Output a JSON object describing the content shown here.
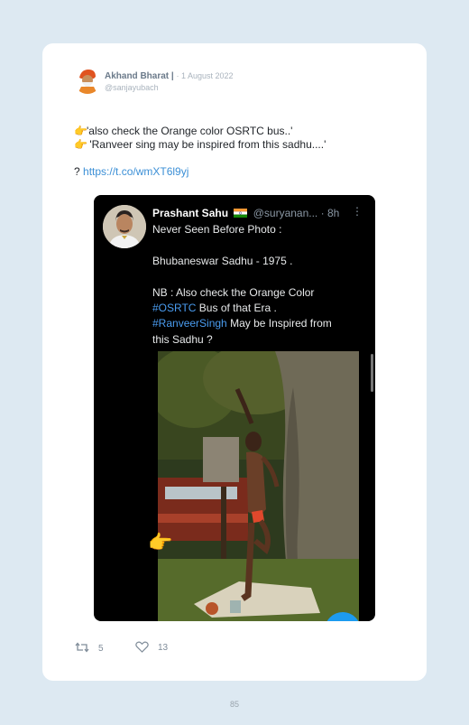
{
  "tweet": {
    "author_name": "Akhand Bharat |",
    "date": "· 1 August 2022",
    "handle": "@sanjayubach",
    "line1_text": "'also check the Orange color OSRTC bus..'",
    "line2_text": " 'Ranveer sing may be inspired from this sadhu....'",
    "line3_prefix": "? ",
    "link": "https://t.co/wmXT6l9yj",
    "hand_emoji": "👉",
    "retweet_count": "5",
    "like_count": "13"
  },
  "embed": {
    "name": "Prashant Sahu",
    "handle": "@suryanan...",
    "time": "· 8h",
    "more": "⋮",
    "text1": "Never Seen Before Photo :",
    "text2": "Bhubaneswar Sadhu - 1975 .",
    "text3": "NB : Also check the Orange Color",
    "hashtag1": "#OSRTC",
    "text4": " Bus of that Era .",
    "hashtag2": "#RanveerSingh",
    "text5": " May be Inspired from",
    "text6": "this Sadhu ?"
  },
  "pointer_emoji": "👉",
  "page_number": "85",
  "colors": {
    "page_bg": "#dde9f2",
    "link": "#3b8fd6",
    "hashtag": "#4a9cf0",
    "embed_bg": "#000000"
  },
  "icons": [
    "retweet-icon",
    "heart-icon",
    "more-icon",
    "india-flag-icon"
  ]
}
